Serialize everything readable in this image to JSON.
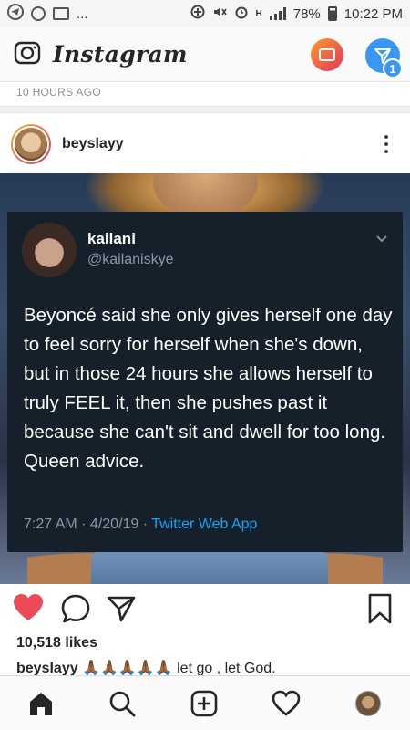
{
  "status_bar": {
    "left_icons": [
      "telegram-icon",
      "imo-icon",
      "gallery-icon"
    ],
    "left_more": "...",
    "right_icons": [
      "data-saver-icon",
      "mute-icon",
      "alarm-icon",
      "signal-icon",
      "battery-icon"
    ],
    "network": "H",
    "battery": "78%",
    "time": "10:22 PM"
  },
  "header": {
    "app_name": "Instagram",
    "camera_icon": "camera-icon",
    "igtv_icon": "igtv-icon",
    "direct_icon": "direct-message-icon",
    "direct_badge": "1"
  },
  "feed": {
    "time_ago": "10 HOURS AGO"
  },
  "post": {
    "username": "beyslayy",
    "more_icon": "more-options-icon",
    "tweet": {
      "name": "kailani",
      "handle": "@kailaniskye",
      "text": "Beyoncé said she only gives herself one day to feel sorry for herself when she's down, but in those 24 hours she allows herself to truly FEEL it, then she pushes past it because she can't sit and dwell for too long. Queen advice.",
      "time": "7:27 AM · 4/20/19 · ",
      "app": "Twitter Web App"
    },
    "actions": {
      "like_icon": "heart-filled-icon",
      "comment_icon": "comment-icon",
      "share_icon": "share-icon",
      "save_icon": "bookmark-icon",
      "like_color": "#ed4956"
    },
    "likes": "10,518 likes",
    "caption_user": "beyslayy",
    "caption_emoji": "🙏🏾🙏🏾🙏🏾🙏🏾🙏🏾",
    "caption_text": "let go , let God."
  },
  "bottom_nav": {
    "items": [
      {
        "name": "home-icon"
      },
      {
        "name": "search-icon"
      },
      {
        "name": "new-post-icon"
      },
      {
        "name": "activity-icon"
      },
      {
        "name": "profile-avatar"
      }
    ]
  }
}
